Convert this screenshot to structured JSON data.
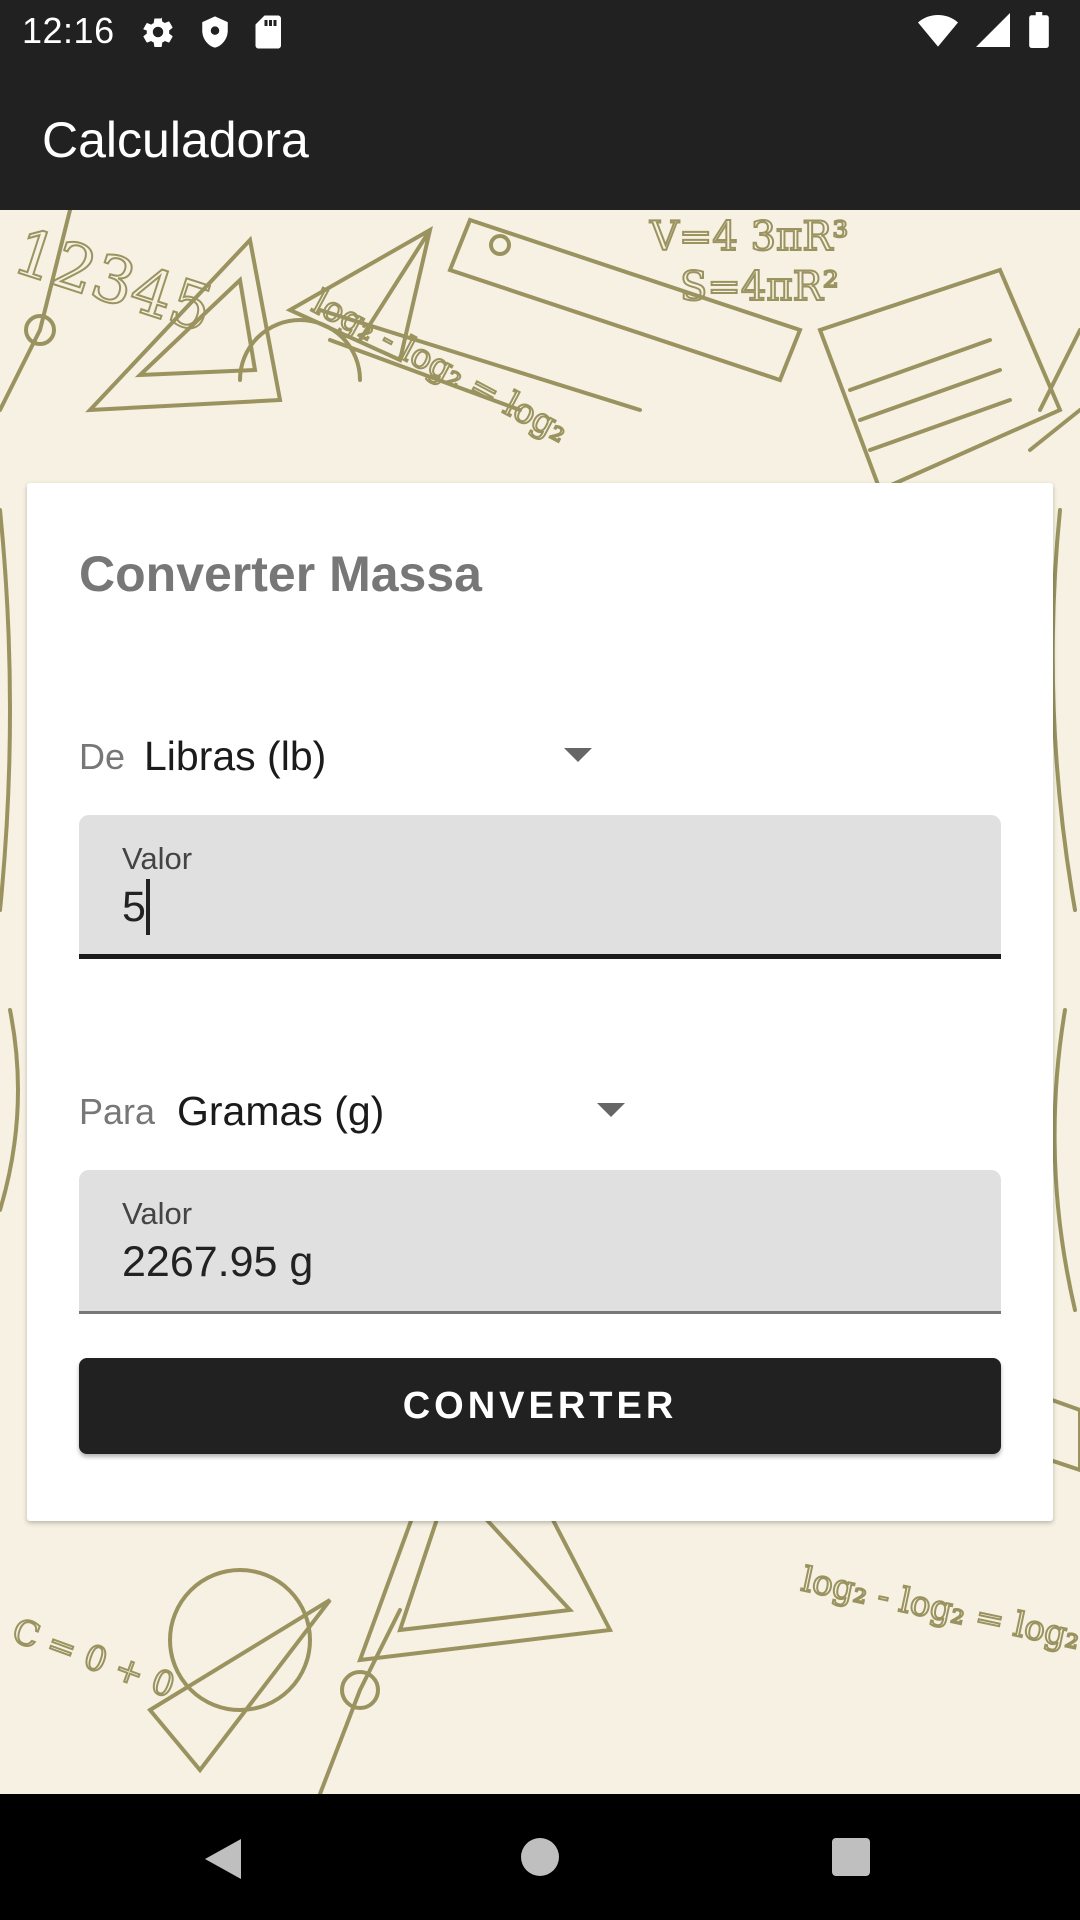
{
  "status_bar": {
    "time": "12:16",
    "left_icons": [
      "gear-icon",
      "shield-icon",
      "sd-card-icon"
    ],
    "right_icons": [
      "wifi-icon",
      "signal-icon",
      "battery-icon"
    ]
  },
  "app_bar": {
    "title": "Calculadora"
  },
  "converter": {
    "title": "Converter Massa",
    "from": {
      "label": "De",
      "unit": "Libras (lb)",
      "value_label": "Valor",
      "value": "5"
    },
    "to": {
      "label": "Para",
      "unit": "Gramas (g)",
      "value_label": "Valor",
      "value": "2267.95 g"
    },
    "button_label": "CONVERTER"
  },
  "nav_bar": {
    "icons": [
      "back-icon",
      "home-icon",
      "recents-icon"
    ]
  },
  "colors": {
    "app_bar": "#212121",
    "background": "#f6f1e2",
    "doodle": "#9a9360",
    "field": "#e0e0e0",
    "button": "#212121"
  }
}
